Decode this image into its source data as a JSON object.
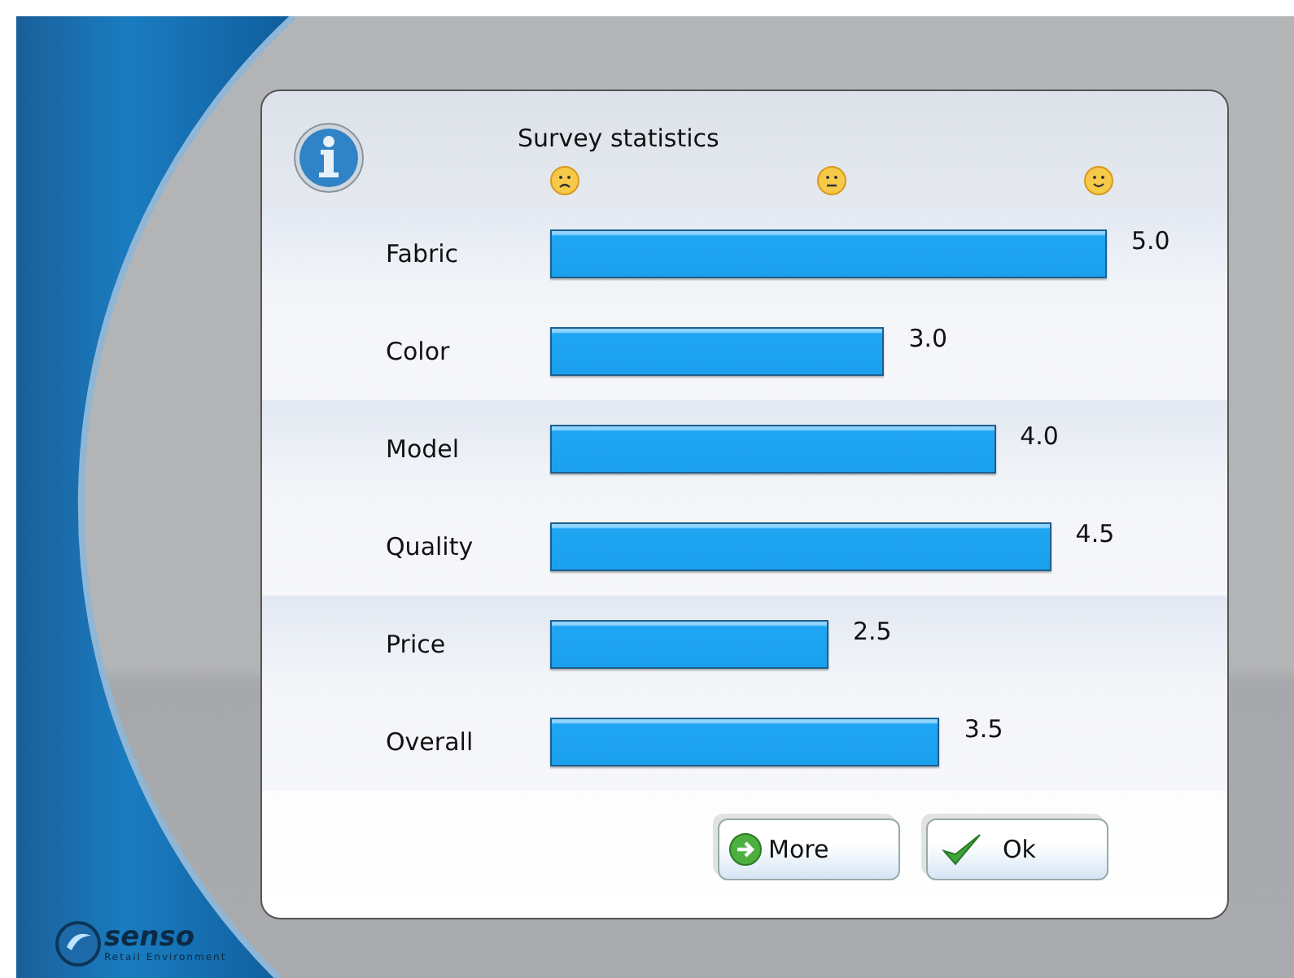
{
  "dialog": {
    "title": "Survey statistics",
    "scale": [
      {
        "kind": "sad"
      },
      {
        "kind": "neutral"
      },
      {
        "kind": "happy"
      }
    ],
    "rows": [
      {
        "label": "Fabric",
        "value": "5.0"
      },
      {
        "label": "Color",
        "value": "3.0"
      },
      {
        "label": "Model",
        "value": "4.0"
      },
      {
        "label": "Quality",
        "value": "4.5"
      },
      {
        "label": "Price",
        "value": "2.5"
      },
      {
        "label": "Overall",
        "value": "3.5"
      }
    ],
    "buttons": [
      {
        "label": "More",
        "kind": "more"
      },
      {
        "label": "Ok",
        "kind": "ok"
      }
    ]
  },
  "logo": {
    "name": "senso",
    "tagline": "Retail Environment"
  }
}
